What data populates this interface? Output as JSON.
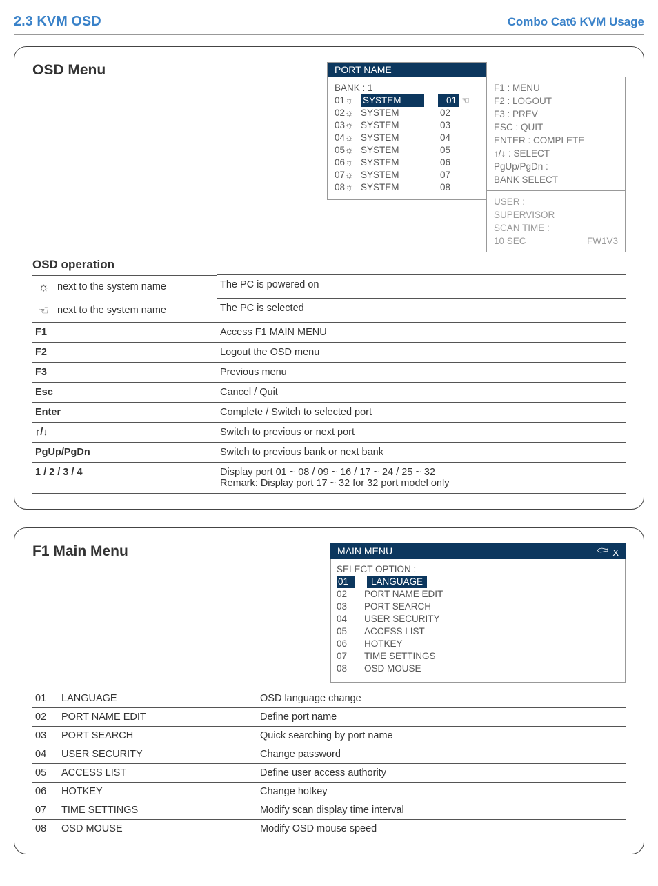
{
  "header": {
    "section": "2.3  KVM OSD",
    "right": "Combo Cat6 KVM Usage"
  },
  "osdMenu": {
    "title": "OSD Menu",
    "portHeader": "PORT   NAME",
    "bank": "BANK : 1",
    "ports": [
      {
        "num": "01",
        "sun": "☼",
        "name": "SYSTEM",
        "num2": "01",
        "sel": true
      },
      {
        "num": "02",
        "sun": "☼",
        "name": "SYSTEM",
        "num2": "02",
        "sel": false
      },
      {
        "num": "03",
        "sun": "☼",
        "name": "SYSTEM",
        "num2": "03",
        "sel": false
      },
      {
        "num": "04",
        "sun": "☼",
        "name": "SYSTEM",
        "num2": "04",
        "sel": false
      },
      {
        "num": "05",
        "sun": "☼",
        "name": "SYSTEM",
        "num2": "05",
        "sel": false
      },
      {
        "num": "06",
        "sun": "☼",
        "name": "SYSTEM",
        "num2": "06",
        "sel": false
      },
      {
        "num": "07",
        "sun": "☼",
        "name": "SYSTEM",
        "num2": "07",
        "sel": false
      },
      {
        "num": "08",
        "sun": "☼",
        "name": "SYSTEM",
        "num2": "08",
        "sel": false
      }
    ],
    "hints": [
      "F1 : MENU",
      "F2 : LOGOUT",
      "F3 : PREV",
      "ESC : QUIT",
      "ENTER : COMPLETE",
      "↑/↓ : SELECT",
      "PgUp/PgDn :",
      "BANK SELECT"
    ],
    "status": {
      "user": "USER :",
      "role": "SUPERVISOR",
      "scantime": "SCAN TIME :",
      "sec": "10 SEC",
      "fw": "FW1V3"
    },
    "opHeading": "OSD operation",
    "ops": [
      {
        "key": "sun",
        "label": "next to the system name",
        "desc": "The PC is powered on"
      },
      {
        "key": "hand",
        "label": "next to the system name",
        "desc": "The PC is selected"
      },
      {
        "key": "F1",
        "desc": "Access F1 MAIN MENU"
      },
      {
        "key": "F2",
        "desc": "Logout the OSD menu"
      },
      {
        "key": "F3",
        "desc": "Previous menu"
      },
      {
        "key": "Esc",
        "desc": "Cancel / Quit"
      },
      {
        "key": "Enter",
        "desc": "Complete / Switch to selected port"
      },
      {
        "key": "↑/↓",
        "desc": "Switch to previous or next port"
      },
      {
        "key": "PgUp/PgDn",
        "desc": "Switch to previous bank or next bank"
      },
      {
        "key": "1 / 2 / 3 / 4",
        "desc": "Display port  01 ~ 08 / 09 ~ 16 / 17 ~ 24 / 25 ~ 32\nRemark:  Display port 17 ~ 32 for 32 port model only"
      }
    ]
  },
  "f1Menu": {
    "title": "F1 Main Menu",
    "header": "MAIN   MENU",
    "selectOption": "SELECT OPTION :",
    "items": [
      {
        "num": "01",
        "name": "LANGUAGE",
        "sel": true
      },
      {
        "num": "02",
        "name": "PORT NAME  EDIT",
        "sel": false
      },
      {
        "num": "03",
        "name": "PORT SEARCH",
        "sel": false
      },
      {
        "num": "04",
        "name": "USER SECURITY",
        "sel": false
      },
      {
        "num": "05",
        "name": "ACCESS LIST",
        "sel": false
      },
      {
        "num": "06",
        "name": "HOTKEY",
        "sel": false
      },
      {
        "num": "07",
        "name": "TIME SETTINGS",
        "sel": false
      },
      {
        "num": "08",
        "name": "OSD MOUSE",
        "sel": false
      }
    ],
    "descTable": [
      {
        "num": "01",
        "name": "LANGUAGE",
        "desc": "OSD language change"
      },
      {
        "num": "02",
        "name": "PORT NAME EDIT",
        "desc": "Define port name"
      },
      {
        "num": "03",
        "name": "PORT SEARCH",
        "desc": "Quick searching by port name"
      },
      {
        "num": "04",
        "name": "USER SECURITY",
        "desc": "Change password"
      },
      {
        "num": "05",
        "name": "ACCESS LIST",
        "desc": "Define user access authority"
      },
      {
        "num": "06",
        "name": "HOTKEY",
        "desc": "Change hotkey"
      },
      {
        "num": "07",
        "name": "TIME SETTINGS",
        "desc": "Modify scan display time interval"
      },
      {
        "num": "08",
        "name": "OSD MOUSE",
        "desc": "Modify OSD mouse speed"
      }
    ]
  }
}
